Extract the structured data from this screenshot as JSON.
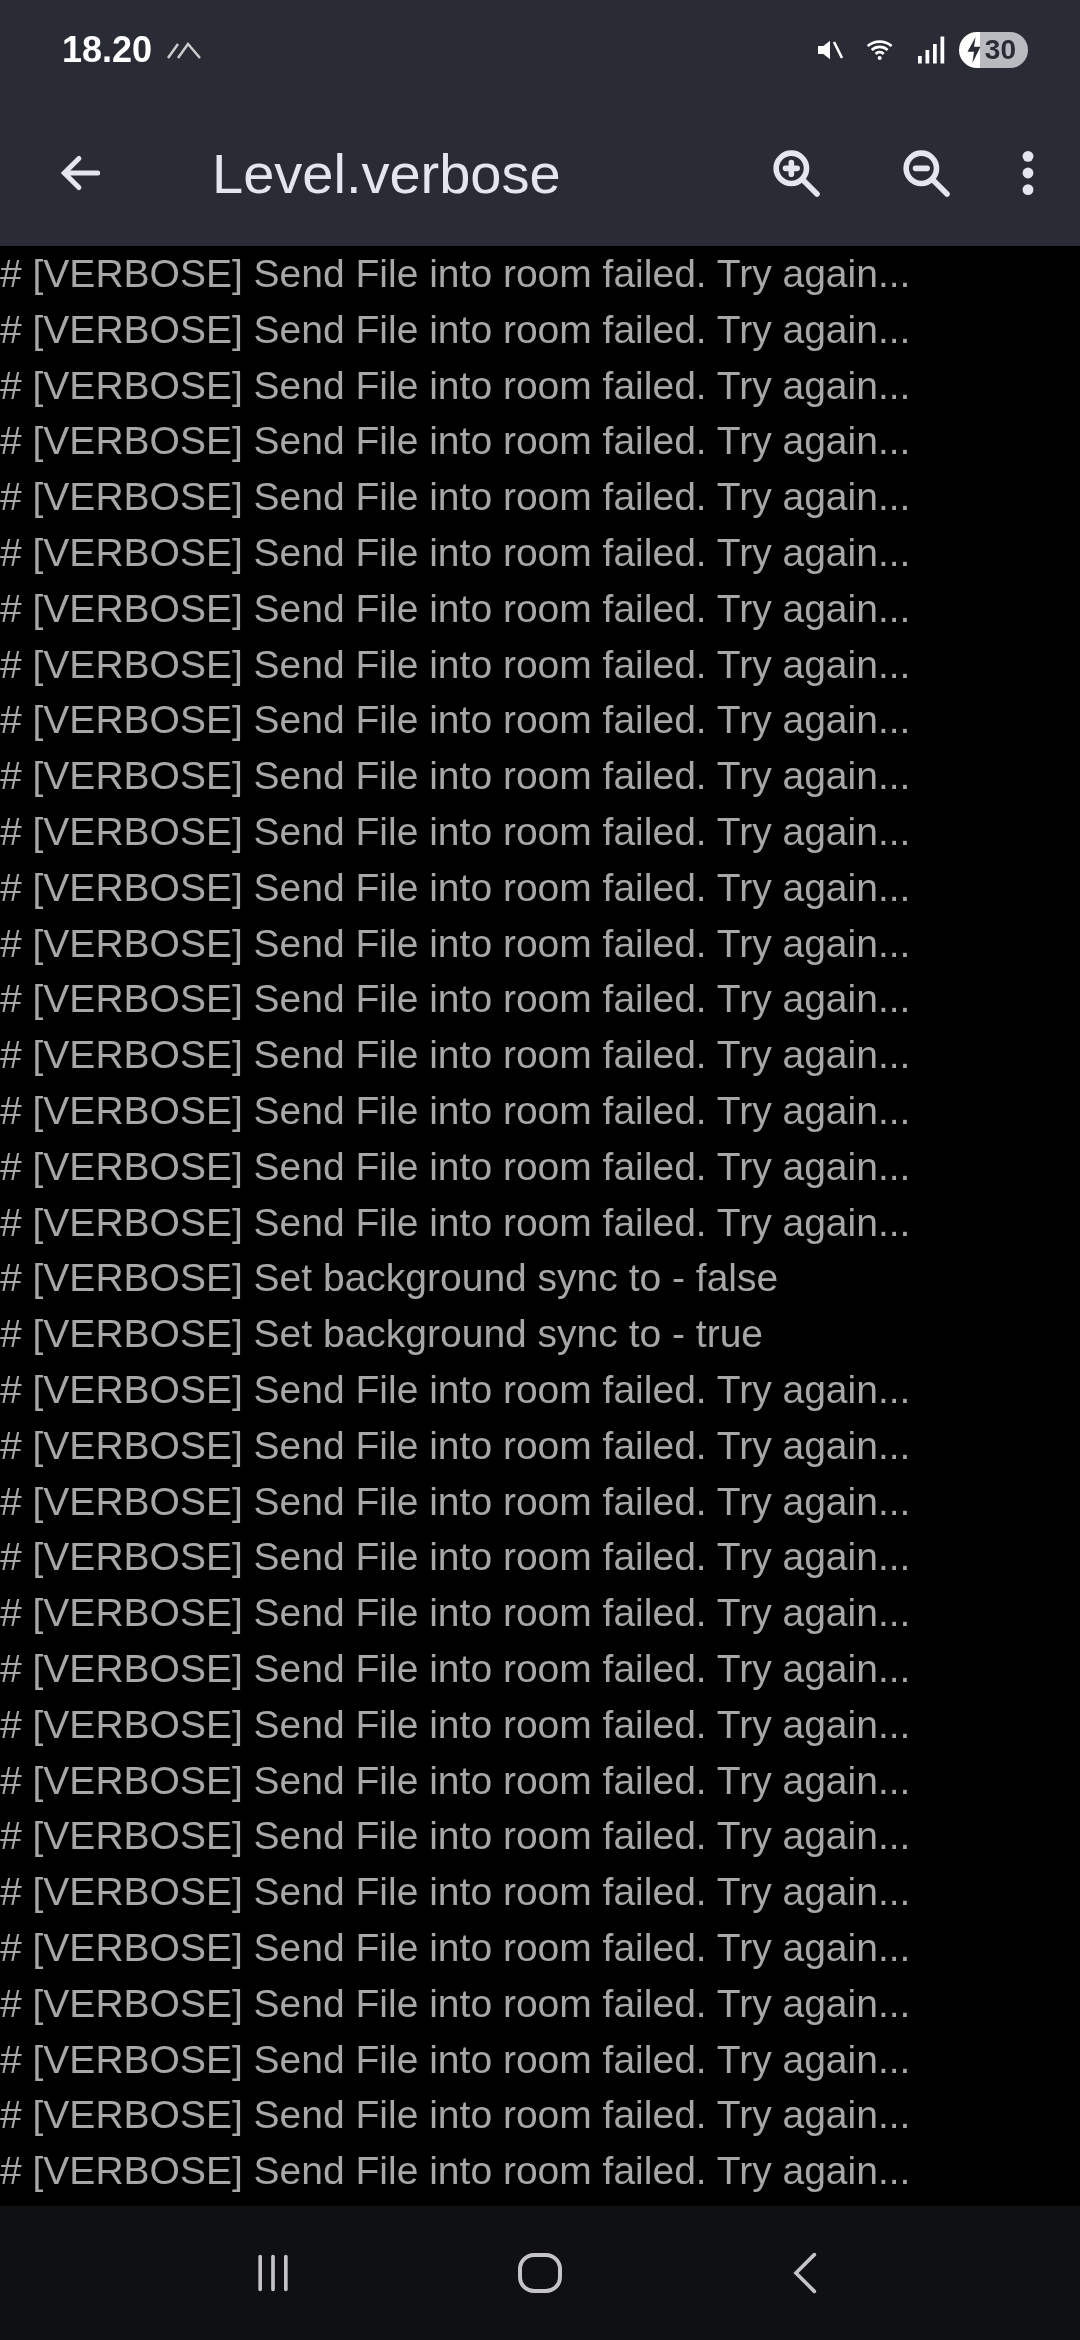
{
  "status_bar": {
    "time": "18.20",
    "battery": "30"
  },
  "app_bar": {
    "title": "Level.verbose"
  },
  "log_lines": [
    "# [VERBOSE] Send File into room failed. Try again...",
    "# [VERBOSE] Send File into room failed. Try again...",
    "# [VERBOSE] Send File into room failed. Try again...",
    "# [VERBOSE] Send File into room failed. Try again...",
    "# [VERBOSE] Send File into room failed. Try again...",
    "# [VERBOSE] Send File into room failed. Try again...",
    "# [VERBOSE] Send File into room failed. Try again...",
    "# [VERBOSE] Send File into room failed. Try again...",
    "# [VERBOSE] Send File into room failed. Try again...",
    "# [VERBOSE] Send File into room failed. Try again...",
    "# [VERBOSE] Send File into room failed. Try again...",
    "# [VERBOSE] Send File into room failed. Try again...",
    "# [VERBOSE] Send File into room failed. Try again...",
    "# [VERBOSE] Send File into room failed. Try again...",
    "# [VERBOSE] Send File into room failed. Try again...",
    "# [VERBOSE] Send File into room failed. Try again...",
    "# [VERBOSE] Send File into room failed. Try again...",
    "# [VERBOSE] Send File into room failed. Try again...",
    "# [VERBOSE] Set background sync to - false",
    "# [VERBOSE] Set background sync to - true",
    "# [VERBOSE] Send File into room failed. Try again...",
    "# [VERBOSE] Send File into room failed. Try again...",
    "# [VERBOSE] Send File into room failed. Try again...",
    "# [VERBOSE] Send File into room failed. Try again...",
    "# [VERBOSE] Send File into room failed. Try again...",
    "# [VERBOSE] Send File into room failed. Try again...",
    "# [VERBOSE] Send File into room failed. Try again...",
    "# [VERBOSE] Send File into room failed. Try again...",
    "# [VERBOSE] Send File into room failed. Try again...",
    "# [VERBOSE] Send File into room failed. Try again...",
    "# [VERBOSE] Send File into room failed. Try again...",
    "# [VERBOSE] Send File into room failed. Try again...",
    "# [VERBOSE] Send File into room failed. Try again...",
    "# [VERBOSE] Send File into room failed. Try again...",
    "# [VERBOSE] Send File into room failed. Try again..."
  ]
}
